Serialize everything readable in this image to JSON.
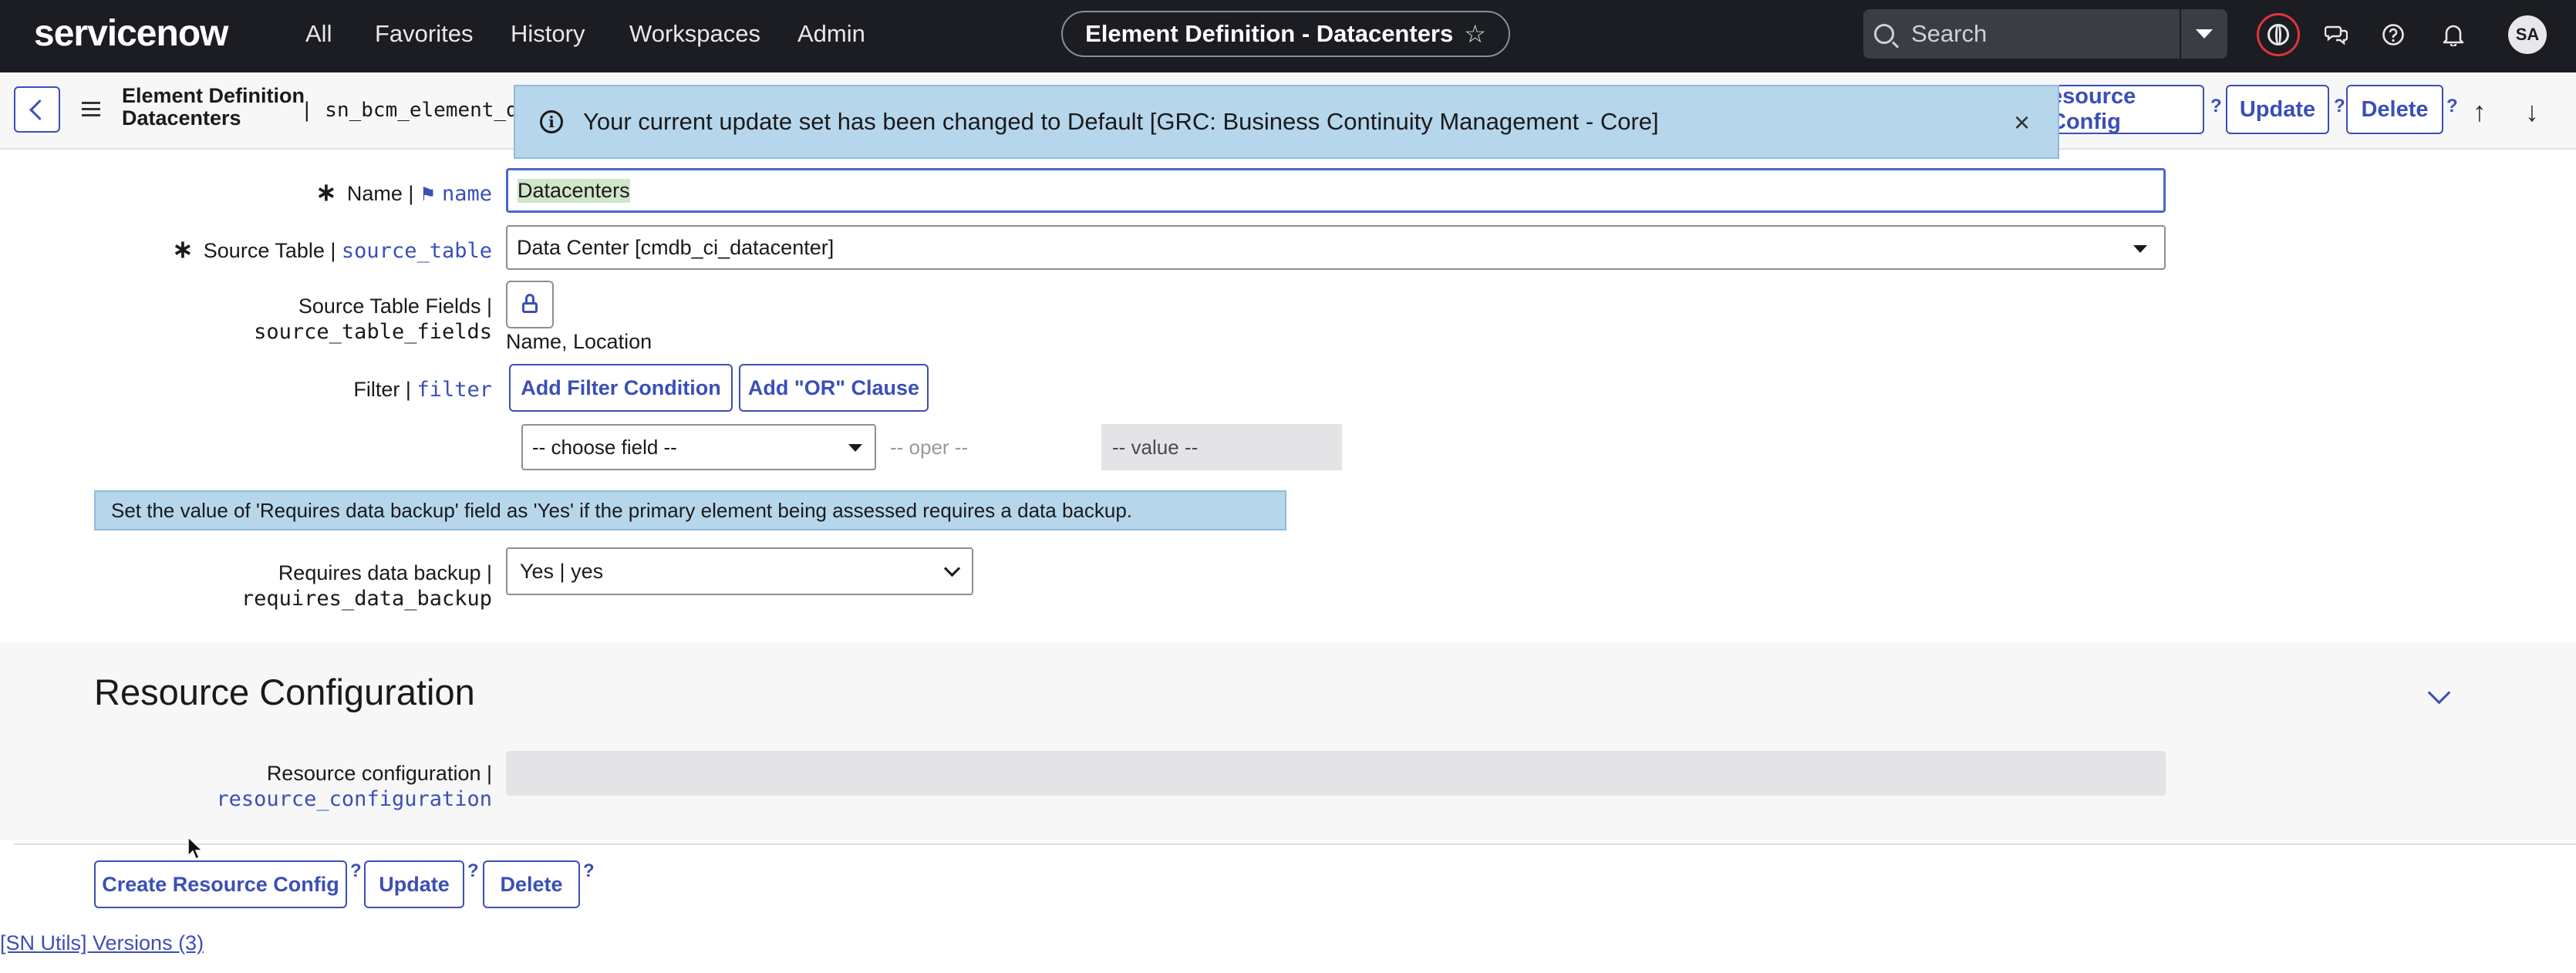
{
  "nav": {
    "logo": "servicenow",
    "links": [
      "All",
      "Favorites",
      "History",
      "Workspaces",
      "Admin"
    ],
    "context_title": "Element Definition - Datacenters",
    "search_placeholder": "Search",
    "avatar_initials": "SA",
    "icons": [
      "globe-icon",
      "chat-icon",
      "help-icon",
      "bell-icon"
    ]
  },
  "header": {
    "title_line1": "Element Definition",
    "title_line2": "Datacenters",
    "table_name": "| sn_bcm_element_defi",
    "buttons": {
      "resource_config": "esource Config",
      "update": "Update",
      "delete": "Delete",
      "help": "?"
    }
  },
  "notification": {
    "message": "Your current update set has been changed to Default [GRC: Business Continuity Management - Core]",
    "close": "×"
  },
  "form": {
    "name": {
      "label": "Name |",
      "field": "name",
      "value": "Datacenters"
    },
    "source_table": {
      "label": "Source Table |",
      "field": "source_table",
      "value": "Data Center [cmdb_ci_datacenter]"
    },
    "source_table_fields": {
      "label": "Source Table Fields |",
      "field": "source_table_fields",
      "value": "Name, Location"
    },
    "filter": {
      "label": "Filter |",
      "field": "filter",
      "add_condition": "Add Filter Condition",
      "add_or": "Add \"OR\" Clause",
      "choose_field": "-- choose field --",
      "oper": "-- oper --",
      "value": "-- value --"
    },
    "hint": "Set the value of 'Requires data backup' field as 'Yes' if the primary element being assessed requires a data backup.",
    "requires_data_backup": {
      "label": "Requires data backup |",
      "field": "requires_data_backup",
      "value": "Yes | yes"
    }
  },
  "resource_section": {
    "heading": "Resource Configuration",
    "label": "Resource configuration |",
    "field": "resource_configuration",
    "value": ""
  },
  "footer": {
    "create_resource_config": "Create Resource Config",
    "update": "Update",
    "delete": "Delete",
    "help": "?",
    "sn_utils": "[SN Utils] Versions (3)"
  },
  "colors": {
    "nav_bg": "#1b1d22",
    "accent": "#3b4fb5",
    "info_bg": "#b6d6ec",
    "alert_ring": "#e2333c"
  }
}
